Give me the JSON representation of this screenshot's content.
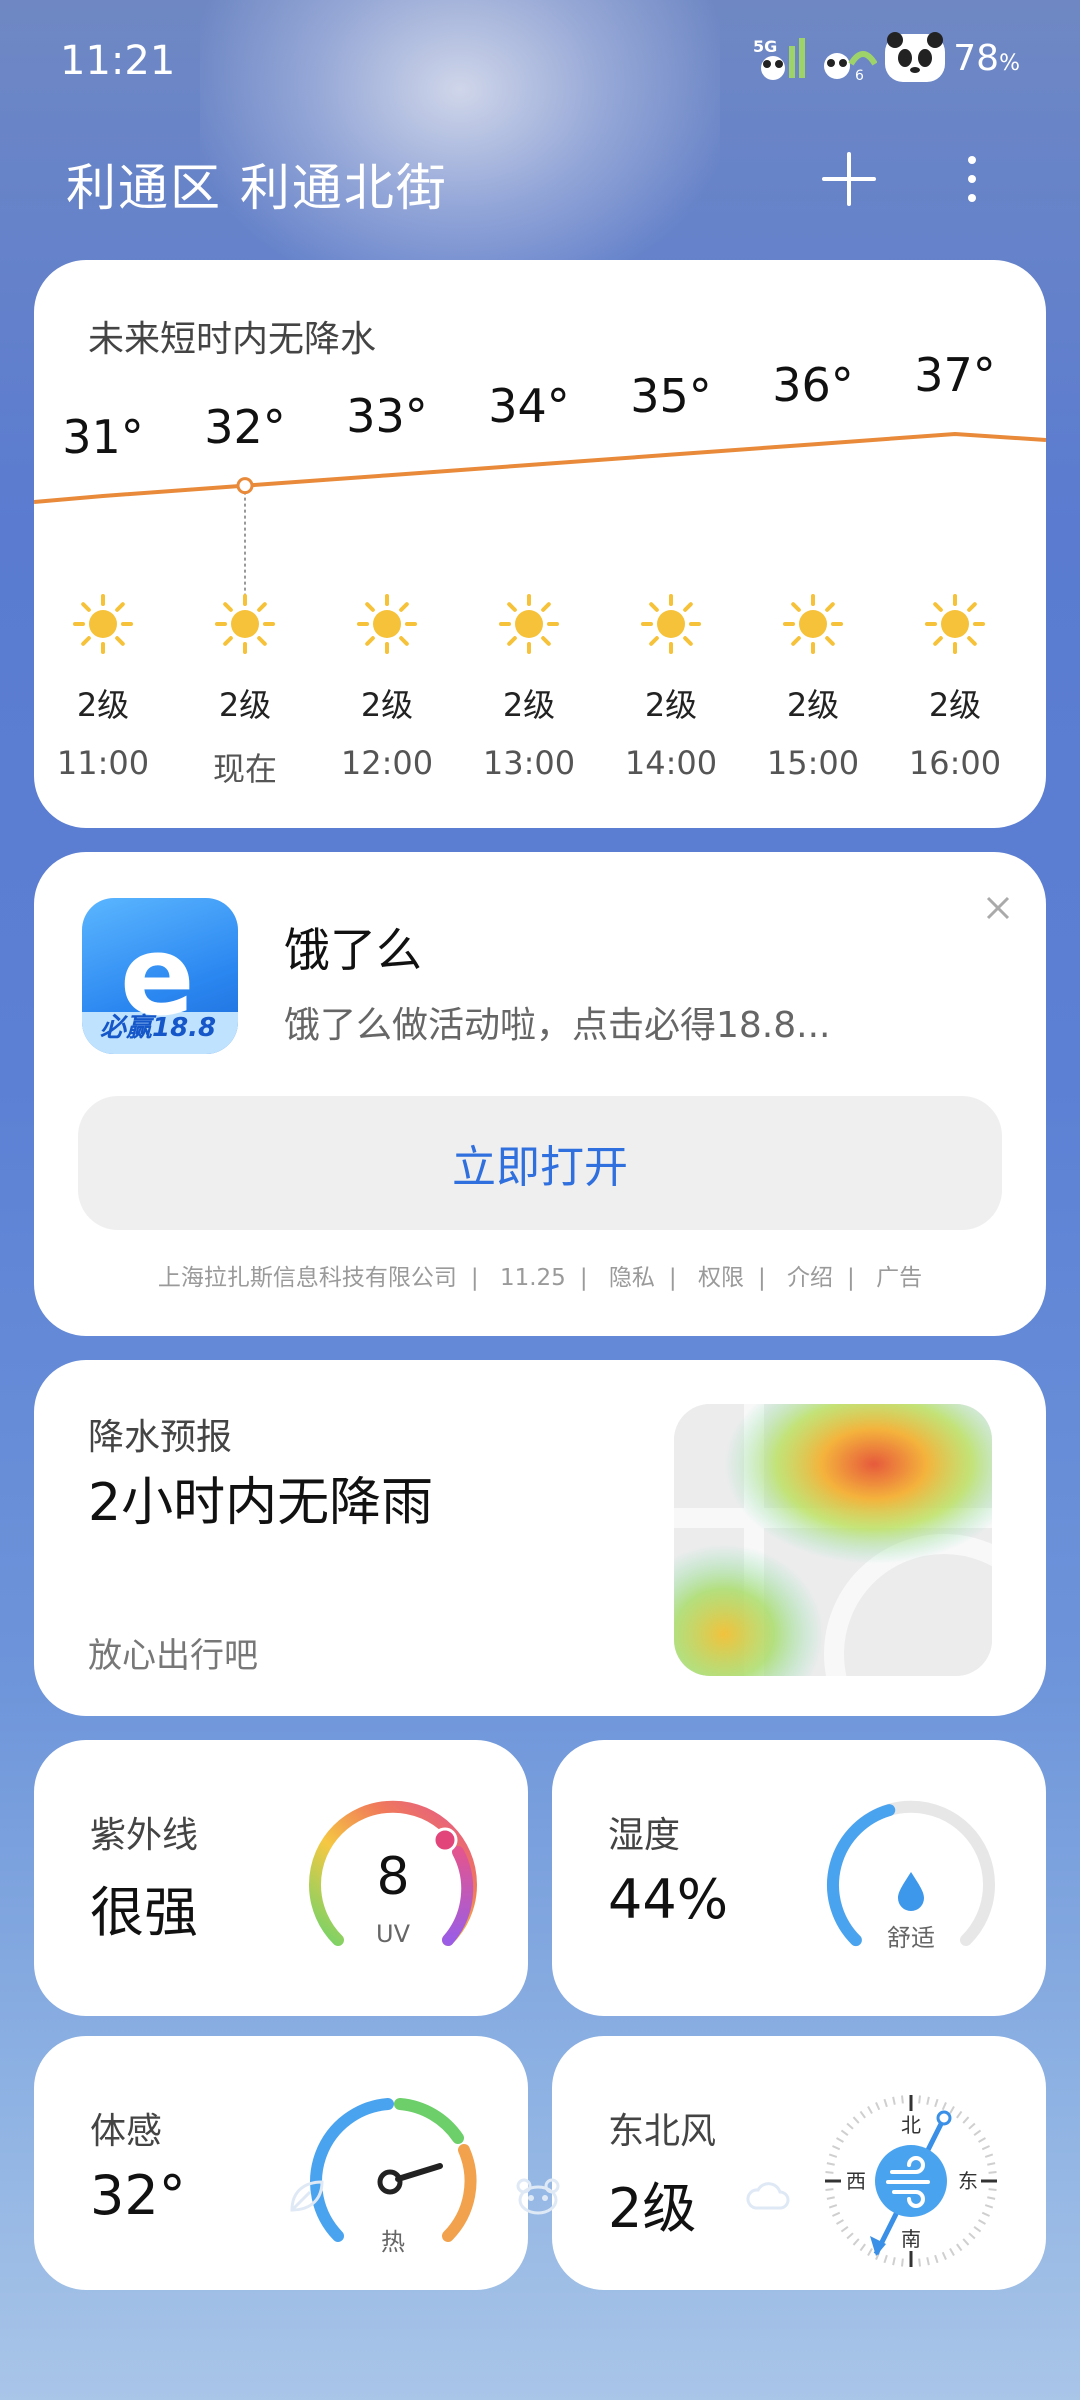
{
  "status_bar": {
    "time": "11:21",
    "network": "5G",
    "battery": "78",
    "battery_unit": "%"
  },
  "header": {
    "location": "利通区 利通北街",
    "add_icon": "plus-icon",
    "more_icon": "more-vertical-icon"
  },
  "hourly": {
    "title": "未来短时内无降水",
    "hours": [
      {
        "time": "11:00",
        "temp": "31°",
        "wind": "2级",
        "icon": "sun-icon"
      },
      {
        "time": "现在",
        "temp": "32°",
        "wind": "2级",
        "icon": "sun-icon"
      },
      {
        "time": "12:00",
        "temp": "33°",
        "wind": "2级",
        "icon": "sun-icon"
      },
      {
        "time": "13:00",
        "temp": "34°",
        "wind": "2级",
        "icon": "sun-icon"
      },
      {
        "time": "14:00",
        "temp": "35°",
        "wind": "2级",
        "icon": "sun-icon"
      },
      {
        "time": "15:00",
        "temp": "36°",
        "wind": "2级",
        "icon": "sun-icon"
      },
      {
        "time": "16:00",
        "temp": "37°",
        "wind": "2级",
        "icon": "sun-icon"
      }
    ],
    "line_color": "#e88a3a"
  },
  "ad": {
    "app_name": "饿了么",
    "description": "饿了么做活动啦，点击必得18.8...",
    "icon_badge": "必赢18.8",
    "button_label": "立即打开",
    "footer": [
      "上海拉扎斯信息科技有限公司",
      "11.25",
      "隐私",
      "权限",
      "介绍",
      "广告"
    ],
    "accent": "#2f6fde"
  },
  "precipitation": {
    "label": "降水预报",
    "value": "2小时内无降雨",
    "subtitle": "放心出行吧"
  },
  "uv": {
    "label": "紫外线",
    "value": "很强",
    "index": "8",
    "unit": "UV"
  },
  "humidity": {
    "label": "湿度",
    "value": "44%",
    "level": 0.44,
    "comfort": "舒适",
    "icon": "water-drop-icon"
  },
  "feels_like": {
    "label": "体感",
    "value": "32°",
    "state": "热"
  },
  "wind": {
    "label": "东北风",
    "value": "2级",
    "directions": {
      "n": "北",
      "s": "南",
      "w": "西",
      "e": "东"
    },
    "icon": "wind-icon"
  },
  "bottom_nav": [
    "leaf-icon",
    "panda-icon",
    "cloud-icon"
  ]
}
